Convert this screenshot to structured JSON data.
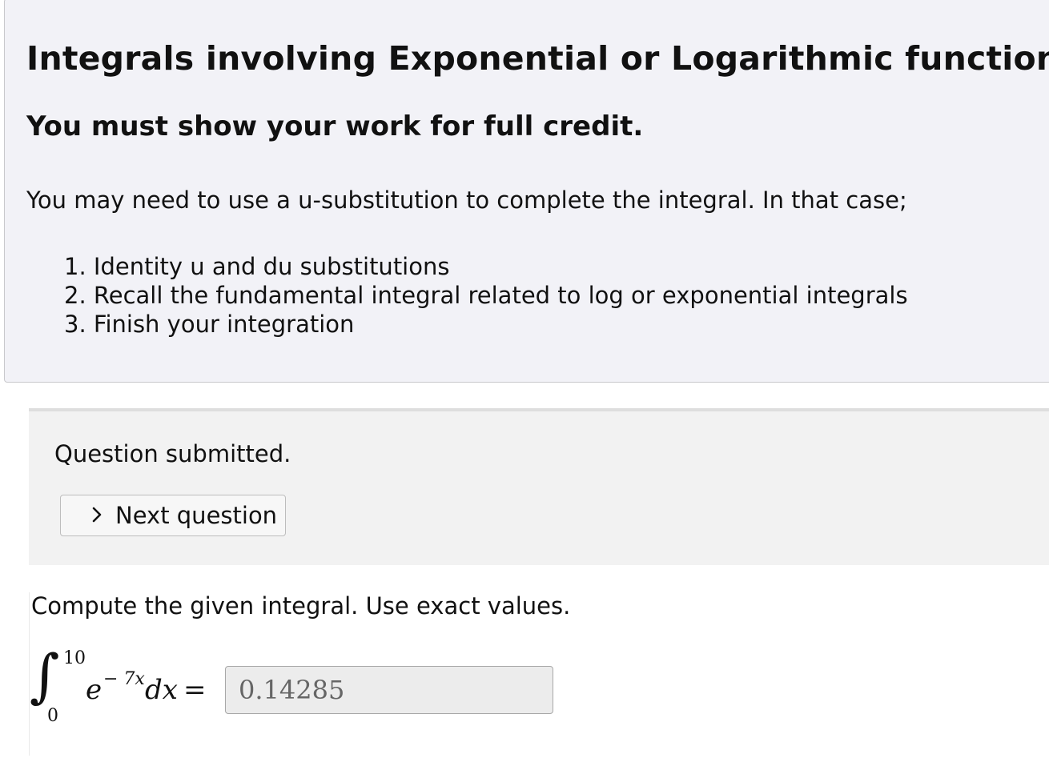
{
  "intro": {
    "title": "Integrals involving Exponential or Logarithmic functions",
    "subtitle": "You must show your work for full credit.",
    "text": "You may need to use a u-substitution to complete the integral.  In that case;",
    "steps": [
      "1. Identity u and du substitutions",
      "2. Recall the fundamental integral related to log or exponential integrals",
      "3. Finish your integration"
    ]
  },
  "status": {
    "message": "Question submitted.",
    "next_label": "Next question",
    "next_icon": "chevron-right-icon"
  },
  "question": {
    "prompt": "Compute the given integral. Use exact values.",
    "integral": {
      "sign": "∫",
      "upper": "10",
      "lower": "0",
      "base": "e",
      "exponent": "− 7x",
      "differential": "dx",
      "equals": "="
    },
    "answer_value": "0.14285"
  }
}
